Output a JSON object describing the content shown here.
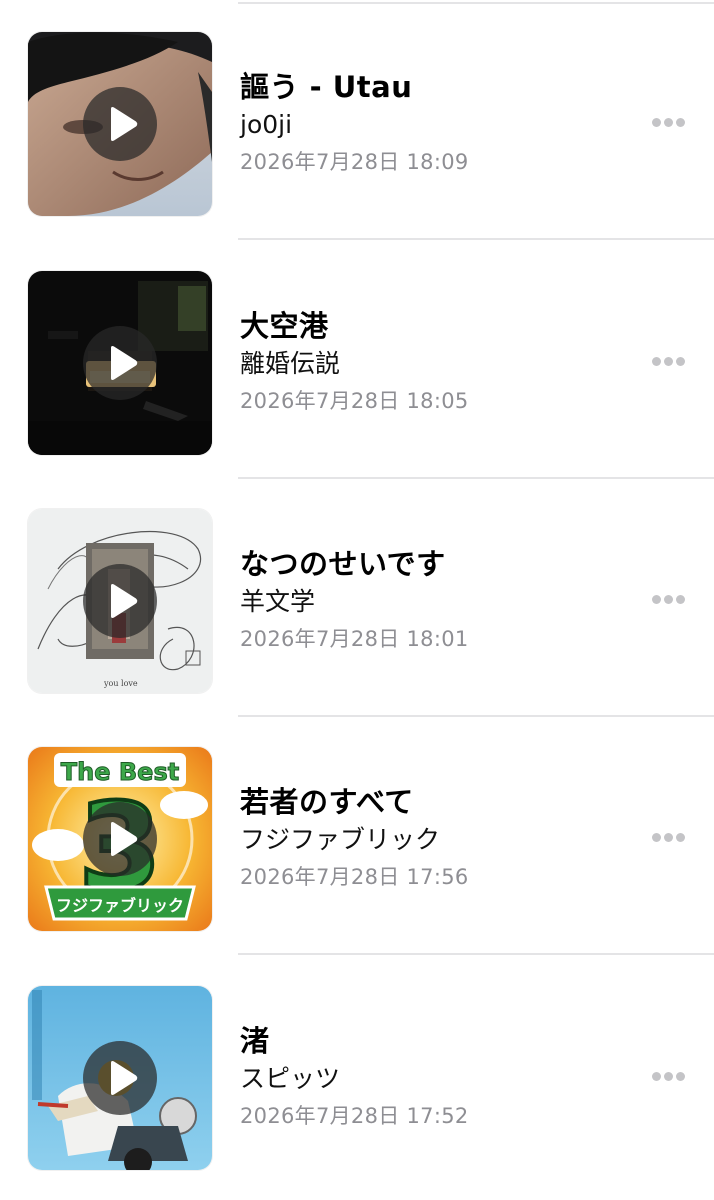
{
  "tracks": [
    {
      "title": "謳う - Utau",
      "artist": "jo0ji",
      "date": "2026年7月28日 18:09",
      "artwork_icon": "portrait-artwork"
    },
    {
      "title": "大空港",
      "artist": "離婚伝説",
      "date": "2026年7月28日 18:05",
      "artwork_icon": "dark-interior-artwork"
    },
    {
      "title": "なつのせいです",
      "artist": "羊文学",
      "date": "2026年7月28日 18:01",
      "artwork_icon": "line-drawing-artwork",
      "artwork_caption": "you love"
    },
    {
      "title": "若者のすべて",
      "artist": "フジファブリック",
      "date": "2026年7月28日 17:56",
      "artwork_icon": "the-best-3-artwork",
      "artwork_banner_top": "The Best",
      "artwork_banner_number": "3",
      "artwork_banner_bottom": "フジファブリック"
    },
    {
      "title": "渚",
      "artist": "スピッツ",
      "date": "2026年7月28日 17:52",
      "artwork_icon": "motorcycle-rider-artwork"
    }
  ],
  "colors": {
    "divider": "#e4e4e6",
    "secondary_text": "#8e8e93",
    "more_dots": "#c4c4c7",
    "play_overlay": "rgba(40,40,40,0.72)"
  }
}
